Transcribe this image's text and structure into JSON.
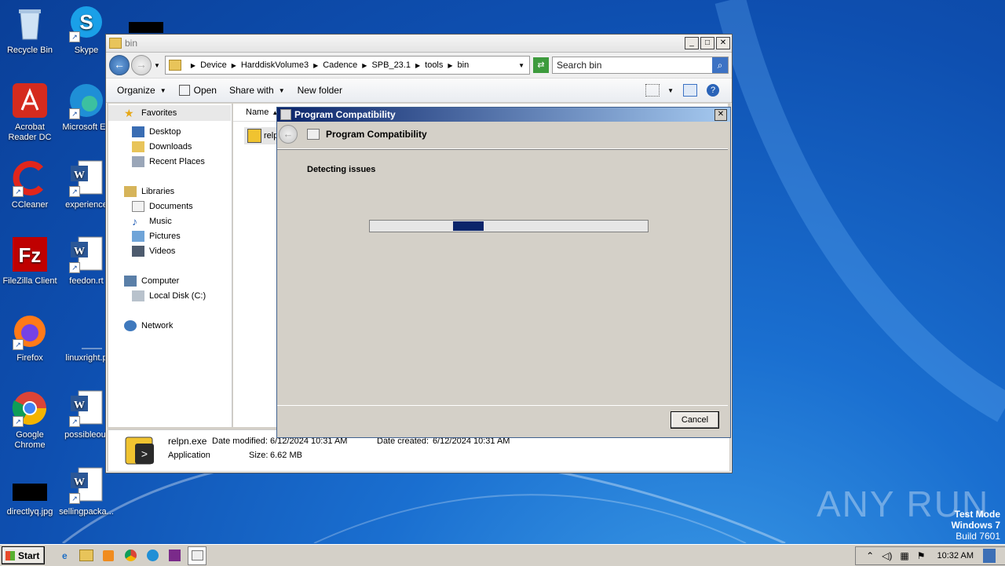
{
  "desktop": {
    "icons": [
      {
        "label": "Recycle Bin",
        "icon": "recycle-bin-icon"
      },
      {
        "label": "Skype",
        "icon": "skype-icon"
      },
      {
        "label": "Acrobat Reader DC",
        "icon": "acrobat-icon"
      },
      {
        "label": "Microsoft Ed",
        "icon": "edge-icon"
      },
      {
        "label": "CCleaner",
        "icon": "ccleaner-icon"
      },
      {
        "label": "experience",
        "icon": "word-doc-icon"
      },
      {
        "label": "FileZilla Client",
        "icon": "filezilla-icon"
      },
      {
        "label": "feedon.rt",
        "icon": "word-doc-icon"
      },
      {
        "label": "Firefox",
        "icon": "firefox-icon"
      },
      {
        "label": "linuxright.p",
        "icon": "blank-file-icon"
      },
      {
        "label": "Google Chrome",
        "icon": "chrome-icon"
      },
      {
        "label": "possibleout",
        "icon": "word-doc-icon"
      },
      {
        "label": "directlyq.jpg",
        "icon": "image-thumb-icon"
      },
      {
        "label": "sellingpacka...",
        "icon": "word-doc-icon"
      }
    ]
  },
  "explorer": {
    "title": "bin",
    "breadcrumb": [
      "Device",
      "HarddiskVolume3",
      "Cadence",
      "SPB_23.1",
      "tools",
      "bin"
    ],
    "search_placeholder": "Search bin",
    "toolbar": {
      "organize": "Organize",
      "open": "Open",
      "share_with": "Share with",
      "new_folder": "New folder"
    },
    "nav": {
      "favorites": "Favorites",
      "desktop": "Desktop",
      "downloads": "Downloads",
      "recent_places": "Recent Places",
      "libraries": "Libraries",
      "documents": "Documents",
      "music": "Music",
      "pictures": "Pictures",
      "videos": "Videos",
      "computer": "Computer",
      "local_disk": "Local Disk (C:)",
      "network": "Network"
    },
    "column_name": "Name",
    "file_item": "relp",
    "details": {
      "filename": "relpn.exe",
      "type": "Application",
      "modified_label": "Date modified:",
      "modified": "6/12/2024 10:31 AM",
      "created_label": "Date created:",
      "created": "6/12/2024 10:31 AM",
      "size_label": "Size:",
      "size": "6.62 MB"
    }
  },
  "dialog": {
    "title": "Program Compatibility",
    "subtitle": "Program Compatibility",
    "status": "Detecting issues",
    "cancel": "Cancel"
  },
  "taskbar": {
    "start": "Start",
    "time": "10:32 AM"
  },
  "watermark": {
    "brand": "ANY RUN",
    "mode_line1": "Test Mode",
    "mode_line2": "Windows 7",
    "mode_line3": "Build 7601"
  },
  "colors": {
    "dialog_title": "#0a246a",
    "desktop": "#1a6fd0"
  }
}
